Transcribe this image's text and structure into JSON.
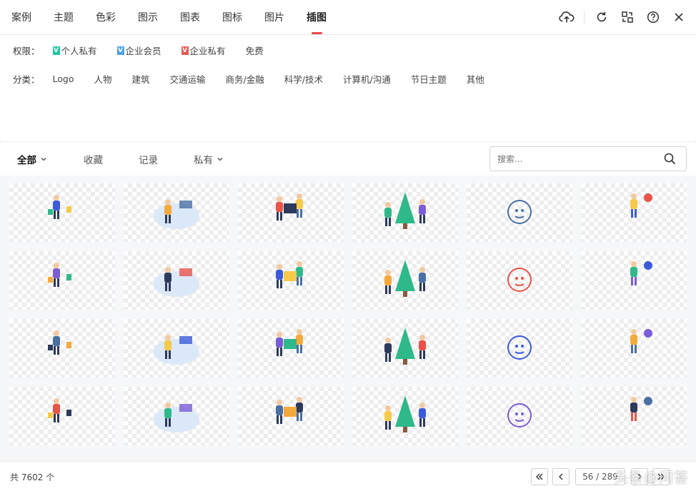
{
  "tabs": [
    {
      "label": "案例",
      "active": false
    },
    {
      "label": "主题",
      "active": false
    },
    {
      "label": "色彩",
      "active": false
    },
    {
      "label": "图示",
      "active": false
    },
    {
      "label": "图表",
      "active": false
    },
    {
      "label": "图标",
      "active": false
    },
    {
      "label": "图片",
      "active": false
    },
    {
      "label": "插图",
      "active": true
    }
  ],
  "top_icons": [
    "upload-cloud-icon",
    "refresh-icon",
    "swap-icon",
    "help-icon",
    "close-icon"
  ],
  "filters": {
    "permission": {
      "label": "权限：",
      "options": [
        {
          "label": "个人私有",
          "badge": "V",
          "badge_color": "#1fc8a0"
        },
        {
          "label": "企业会员",
          "badge": "V",
          "badge_color": "#4aa3e8"
        },
        {
          "label": "企业私有",
          "badge": "V",
          "badge_color": "#e55b55"
        },
        {
          "label": "免费",
          "badge": "",
          "badge_color": ""
        }
      ]
    },
    "category": {
      "label": "分类：",
      "options": [
        "Logo",
        "人物",
        "建筑",
        "交通运输",
        "商务/金融",
        "科学/技术",
        "计算机/沟通",
        "节日主题",
        "其他"
      ]
    }
  },
  "subtabs": [
    {
      "label": "全部",
      "active": true,
      "dropdown": true
    },
    {
      "label": "收藏",
      "active": false,
      "dropdown": false
    },
    {
      "label": "记录",
      "active": false,
      "dropdown": false
    },
    {
      "label": "私有",
      "active": false,
      "dropdown": true
    }
  ],
  "search": {
    "placeholder": "搜索..."
  },
  "illustrations": [
    "shopper-with-bags",
    "presentation-board",
    "two-people-with-box",
    "christmas-tree-decorating",
    "snowman-sketch",
    "woman-with-pompom",
    "horse-rider",
    "football-player",
    "team-gears",
    "puzzle-building",
    "transport-train-truck",
    "woman-with-envelope",
    "virus-sketch",
    "puzzle-team-flying",
    "puzzle-stars-team",
    "christmas-tree-gifts",
    "man-holding-gift",
    "woman-shopping-bags",
    "cloud-upload-download",
    "website-builder",
    "laptop-workspace",
    "christmas-tree-child",
    "envelope-letter",
    "gift-exchange"
  ],
  "footer": {
    "total": "共 7602 个",
    "page": "56 / 289"
  },
  "watermark": "头条@问答"
}
